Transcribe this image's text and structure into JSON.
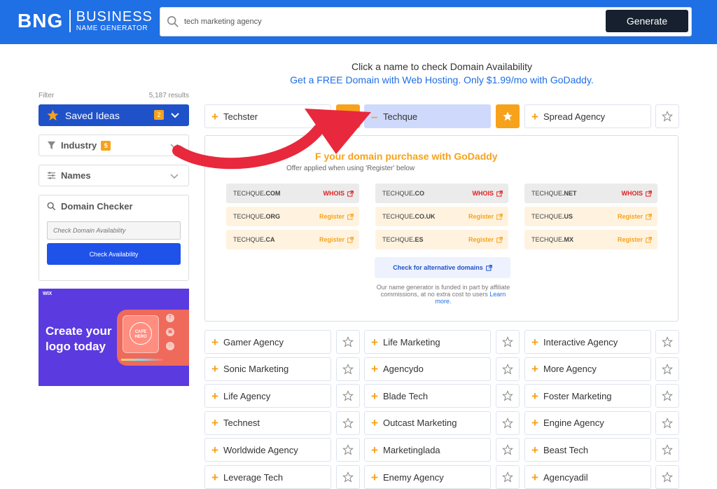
{
  "logo": {
    "mark": "BNG",
    "line1": "BUSINESS",
    "line2": "NAME GENERATOR"
  },
  "search": {
    "value": "tech marketing agency",
    "button": "Generate"
  },
  "header": {
    "line1": "Click a name to check Domain Availability",
    "line2": "Get a FREE Domain with Web Hosting. Only $1.99/mo with GoDaddy."
  },
  "sidebar": {
    "filter_label": "Filter",
    "results": "5,187 results",
    "saved": {
      "label": "Saved Ideas",
      "count": "2"
    },
    "industry": {
      "label": "Industry",
      "count": "5"
    },
    "names": {
      "label": "Names"
    },
    "domain_checker": {
      "title": "Domain Checker",
      "placeholder": "Check Domain Availability",
      "button": "Check Availability"
    },
    "ad": {
      "brand": "WIX",
      "title": "Create your logo today",
      "seal": "CAFE HERO"
    }
  },
  "top_row": [
    {
      "name": "Techster",
      "saved": true
    },
    {
      "name": "Techque",
      "saved": true,
      "selected": true
    },
    {
      "name": "Spread Agency",
      "saved": false
    }
  ],
  "domains": {
    "promo": "F your domain purchase with GoDaddy",
    "promo_sub": "Offer applied when using 'Register' below",
    "list": [
      {
        "base": "TECHQUE",
        "tld": ".COM",
        "action": "WHOIS",
        "status": "taken"
      },
      {
        "base": "TECHQUE",
        "tld": ".CO",
        "action": "WHOIS",
        "status": "taken"
      },
      {
        "base": "TECHQUE",
        "tld": ".NET",
        "action": "WHOIS",
        "status": "taken"
      },
      {
        "base": "TECHQUE",
        "tld": ".ORG",
        "action": "Register",
        "status": "available"
      },
      {
        "base": "TECHQUE",
        "tld": ".CO.UK",
        "action": "Register",
        "status": "available"
      },
      {
        "base": "TECHQUE",
        "tld": ".US",
        "action": "Register",
        "status": "available"
      },
      {
        "base": "TECHQUE",
        "tld": ".CA",
        "action": "Register",
        "status": "available"
      },
      {
        "base": "TECHQUE",
        "tld": ".ES",
        "action": "Register",
        "status": "available"
      },
      {
        "base": "TECHQUE",
        "tld": ".MX",
        "action": "Register",
        "status": "available"
      }
    ],
    "alt_button": "Check for alternative domains",
    "affiliate": "Our name generator is funded in part by affiliate commissions, at no extra cost to users",
    "learn_more": "Learn more."
  },
  "names": [
    [
      "Gamer Agency",
      "Life Marketing",
      "Interactive Agency"
    ],
    [
      "Sonic Marketing",
      "Agencydo",
      "More Agency"
    ],
    [
      "Life Agency",
      "Blade Tech",
      "Foster Marketing"
    ],
    [
      "Technest",
      "Outcast Marketing",
      "Engine Agency"
    ],
    [
      "Worldwide Agency",
      "Marketinglada",
      "Beast Tech"
    ],
    [
      "Leverage Tech",
      "Enemy Agency",
      "Agencyadil"
    ]
  ],
  "colors": {
    "brand": "#1f6fe5",
    "accent": "#f7a21b",
    "arrow": "#e8283c",
    "button_dark": "#16202e"
  }
}
